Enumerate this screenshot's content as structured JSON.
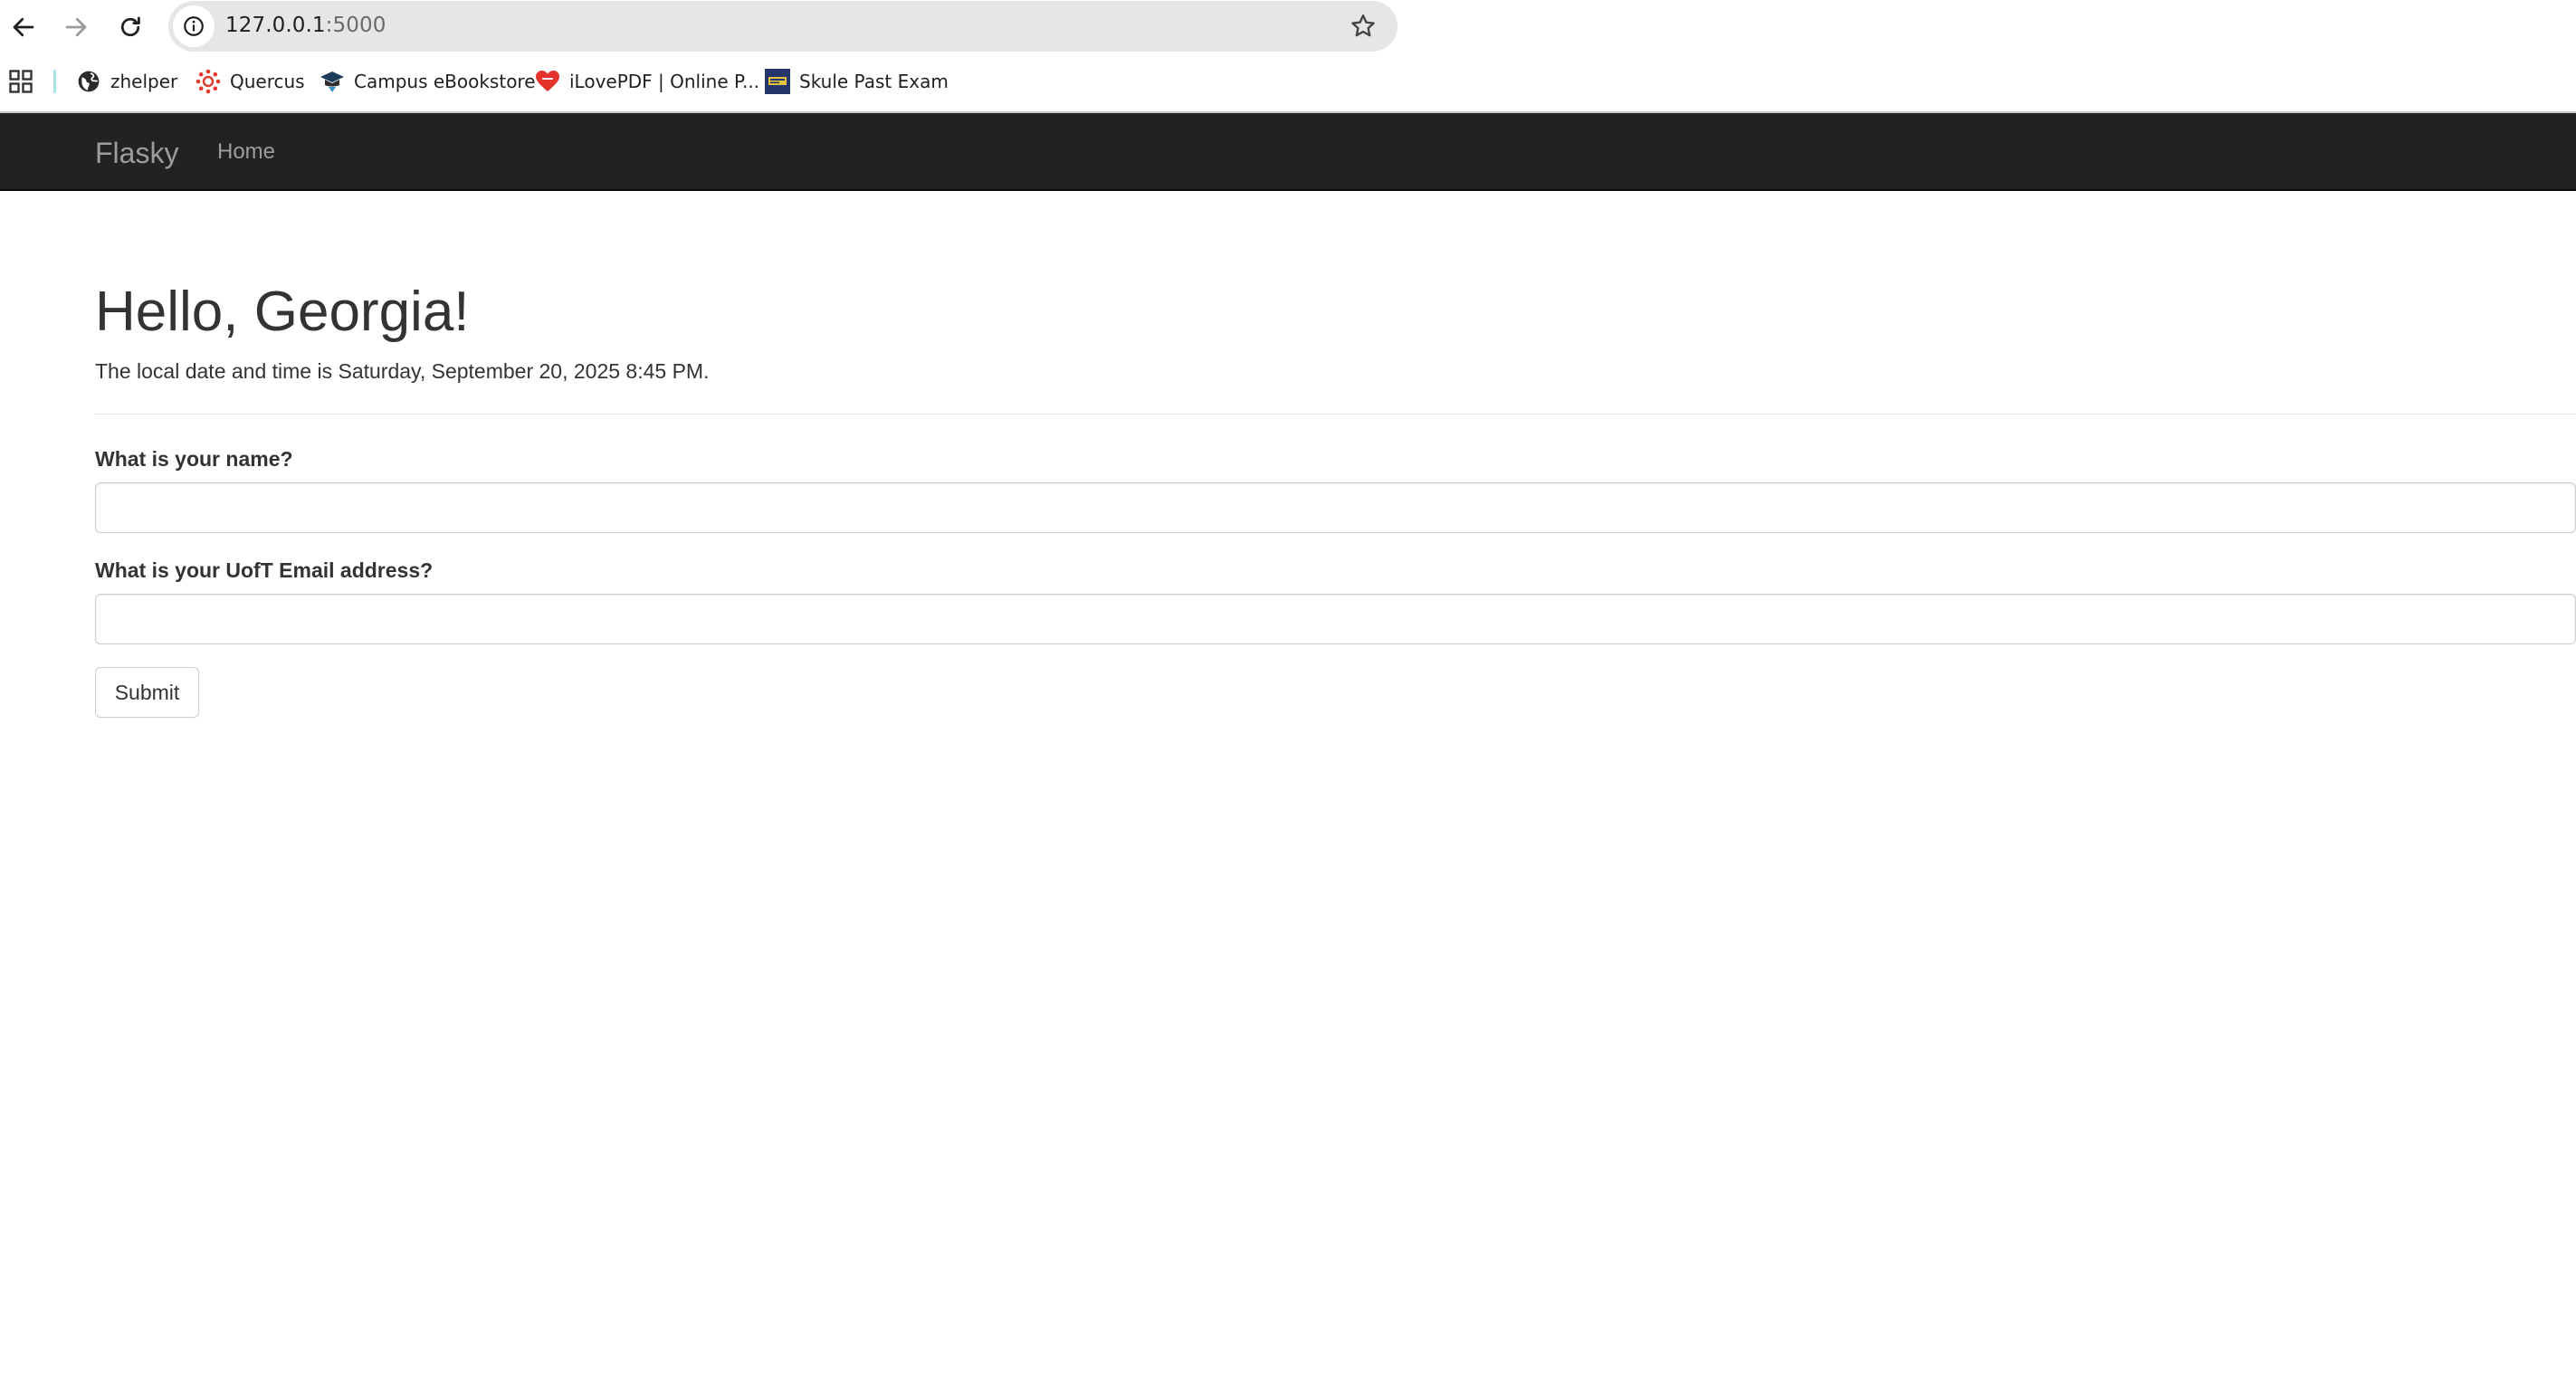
{
  "browser": {
    "url_host": "127.0.0.1",
    "url_port": ":5000",
    "nav_icons": [
      "back-arrow-icon",
      "forward-arrow-icon",
      "reload-icon"
    ],
    "bookmarks": [
      {
        "label": "zhelper",
        "icon": "globe-icon"
      },
      {
        "label": "Quercus",
        "icon": "quercus-icon"
      },
      {
        "label": "Campus eBookstore",
        "icon": "graduation-cap-icon"
      },
      {
        "label": "iLovePDF | Online P...",
        "icon": "heart-icon"
      },
      {
        "label": "Skule Past Exam",
        "icon": "skule-icon"
      }
    ]
  },
  "navbar": {
    "brand": "Flasky",
    "links": [
      {
        "label": "Home"
      }
    ]
  },
  "main": {
    "greeting": "Hello, Georgia!",
    "datetime": "The local date and time is Saturday, September 20, 2025 8:45 PM.",
    "form": {
      "name_label": "What is your name?",
      "name_value": "",
      "email_label": "What is your UofT Email address?",
      "email_value": "",
      "submit_label": "Submit"
    }
  },
  "colors": {
    "navbar_bg": "#222222",
    "navbar_text": "#9d9d9d",
    "body_text": "#333333",
    "omnibox_bg": "#e6e6e6"
  }
}
